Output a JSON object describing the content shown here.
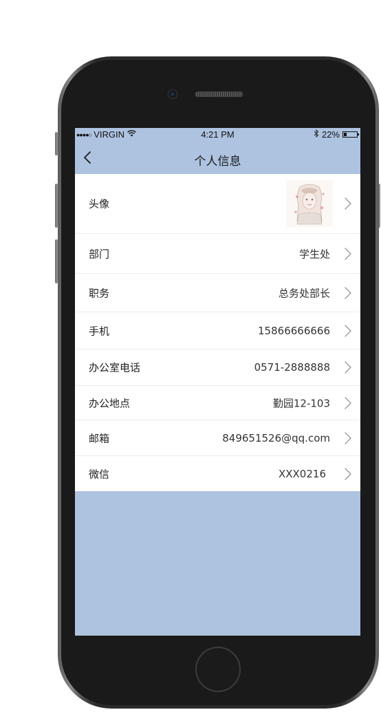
{
  "status_bar": {
    "signal": "●●●●○",
    "carrier": "VIRGIN",
    "wifi_icon": "wifi-icon",
    "time": "4:21 PM",
    "bluetooth_icon": "bluetooth-icon",
    "battery_percent": "22%",
    "battery_level": 0.22
  },
  "nav": {
    "back_icon": "chevron-left-icon",
    "title": "个人信息"
  },
  "rows": [
    {
      "label": "头像",
      "kind": "avatar"
    },
    {
      "label": "部门",
      "value": "学生处"
    },
    {
      "label": "职务",
      "value": "总务处部长"
    },
    {
      "label": "手机",
      "value": "15866666666"
    },
    {
      "label": "办公室电话",
      "value": "0571-2888888"
    },
    {
      "label": "办公地点",
      "value": "勤园12-103"
    },
    {
      "label": "邮箱",
      "value": "849651526@qq.com"
    },
    {
      "label": "微信",
      "value": "XXX0216"
    }
  ],
  "colors": {
    "screen_background": "#adc3e0",
    "list_background": "#ffffff",
    "chevron": "#9a9a9a"
  }
}
